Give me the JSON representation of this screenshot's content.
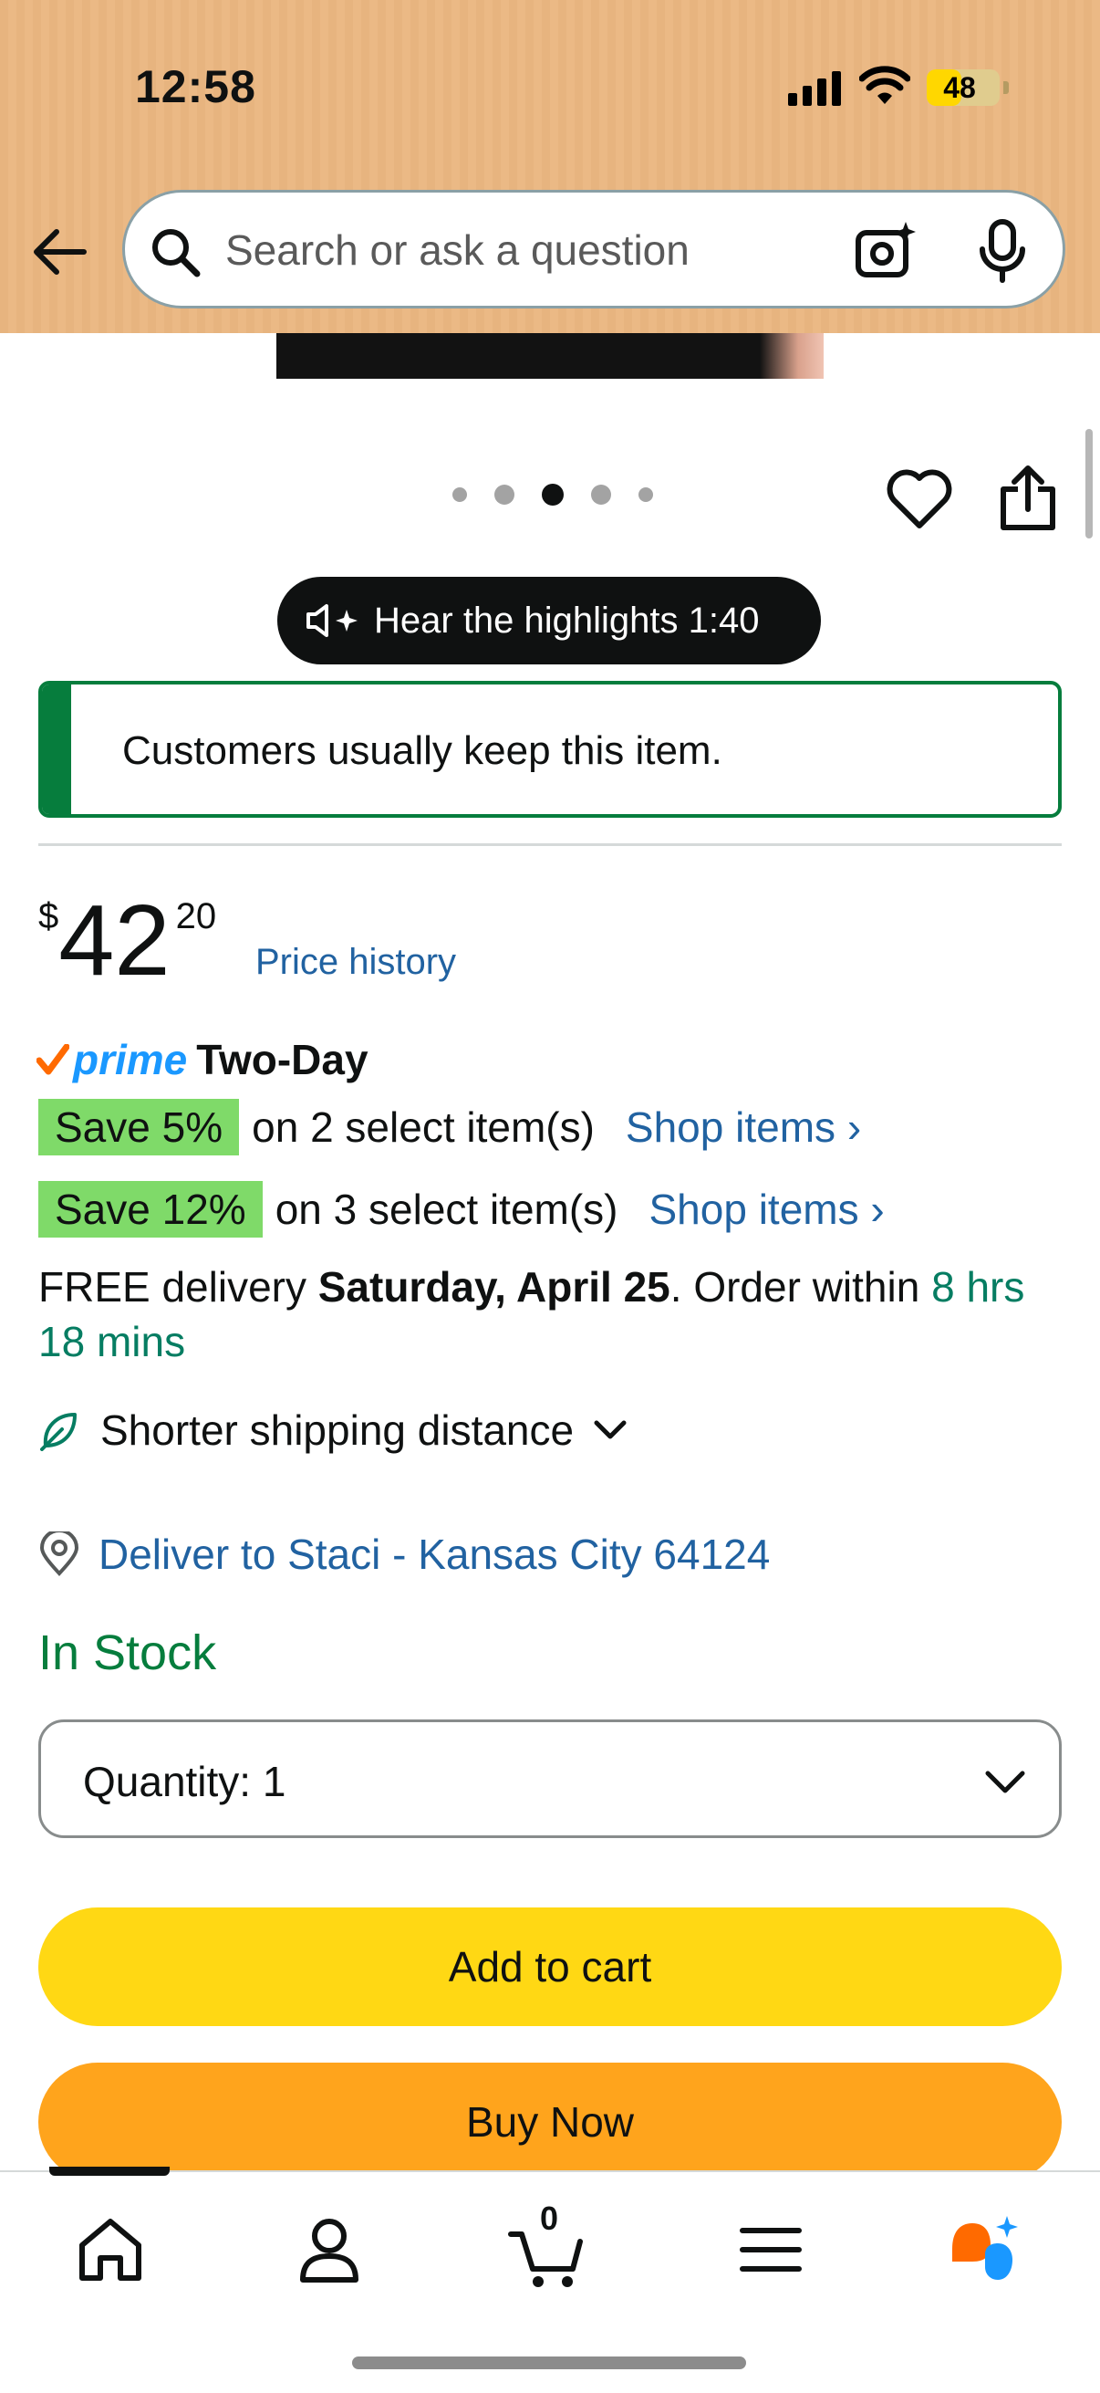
{
  "status_bar": {
    "time": "12:58",
    "battery": "48",
    "battery_level": 0.48
  },
  "search": {
    "placeholder": "Search or ask a question"
  },
  "carousel": {
    "dot_count": 5,
    "active_index": 2
  },
  "highlights": {
    "label": "Hear the highlights 1:40"
  },
  "alert": {
    "text": "Customers usually keep this item."
  },
  "price": {
    "symbol": "$",
    "whole": "42",
    "fraction": "20",
    "history_link": "Price history"
  },
  "prime": {
    "logo": "prime",
    "label": "Two-Day"
  },
  "promos": [
    {
      "badge": "Save 5%",
      "text": "on 2 select item(s)",
      "link": "Shop items ›"
    },
    {
      "badge": "Save 12%",
      "text": "on 3 select item(s)",
      "link": "Shop items ›"
    }
  ],
  "delivery": {
    "prefix": "FREE delivery ",
    "date": "Saturday, April 25",
    "middle": ". Order within ",
    "countdown": "8 hrs 18 mins"
  },
  "shipping": {
    "label": "Shorter shipping distance"
  },
  "deliver_to": {
    "label": "Deliver to Staci - Kansas City 64124"
  },
  "stock": {
    "label": "In Stock"
  },
  "quantity": {
    "label": "Quantity:  1"
  },
  "buttons": {
    "add_to_cart": "Add to cart",
    "buy_now": "Buy Now"
  },
  "nav": {
    "cart_count": "0"
  },
  "colors": {
    "header_bg": "#e7b47f",
    "add_to_cart": "#ffd814",
    "buy_now": "#ffa41c",
    "save_badge": "#7fda69",
    "link": "#2162a1",
    "in_stock": "#067d3d",
    "prime_blue": "#1a98ff",
    "prime_check": "#ff6a00",
    "rufus_orange": "#ff6a00",
    "rufus_blue": "#1a98ff"
  },
  "icons": [
    "back-arrow-icon",
    "search-icon",
    "camera-sparkle-icon",
    "microphone-icon",
    "heart-icon",
    "share-icon",
    "speaker-sparkle-icon",
    "leaf-icon",
    "location-pin-icon",
    "chevron-down-icon",
    "home-icon",
    "account-icon",
    "cart-icon",
    "menu-icon",
    "rufus-ai-icon"
  ]
}
